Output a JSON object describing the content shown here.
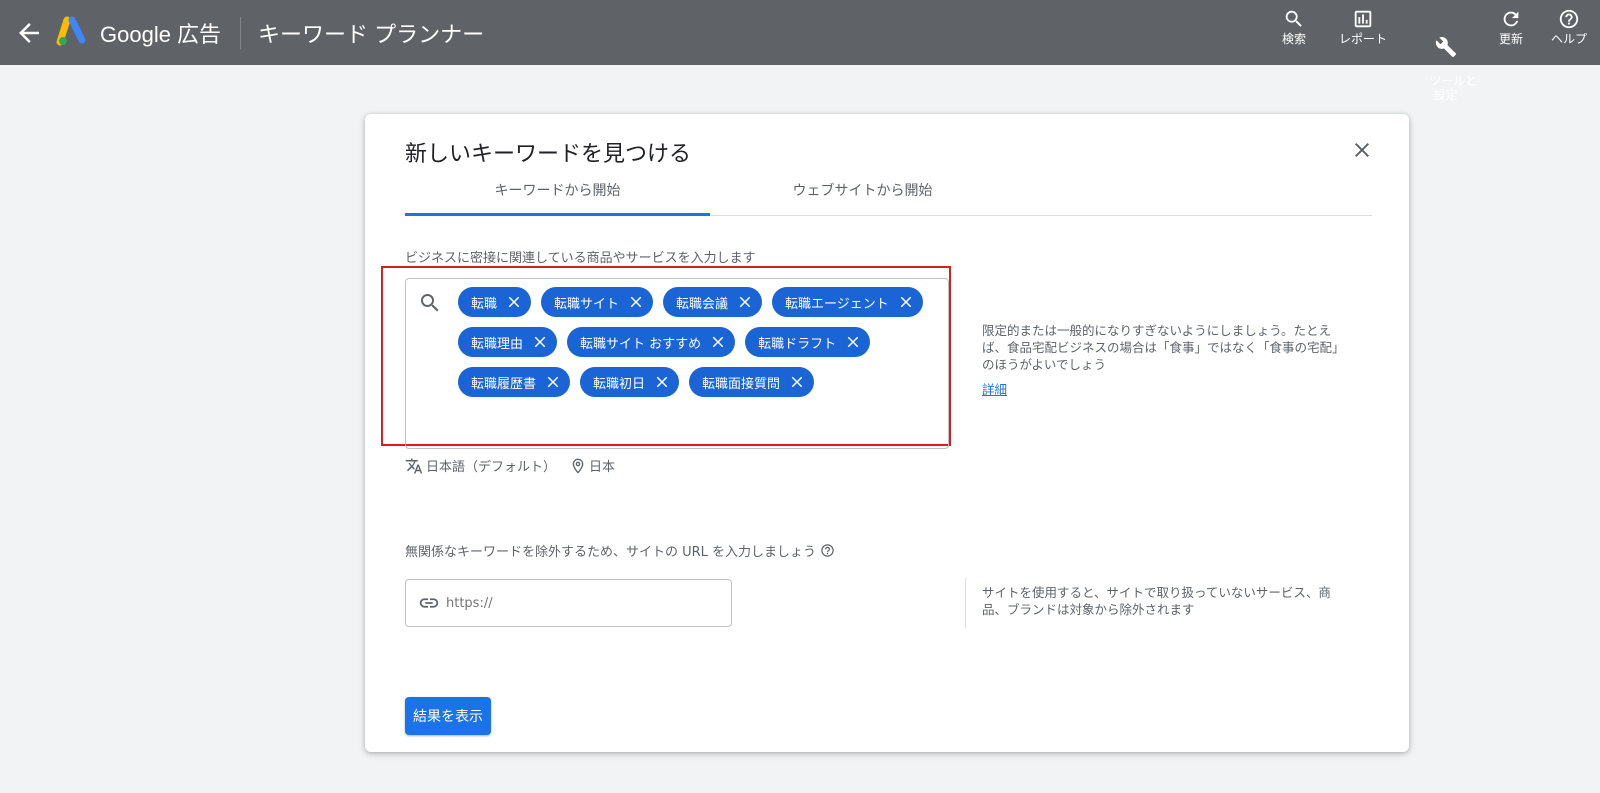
{
  "topbar": {
    "brand": "Google 広告",
    "page_title": "キーワード プランナー",
    "tools": [
      {
        "label": "検索",
        "icon": "search-icon"
      },
      {
        "label": "レポート",
        "icon": "bar-chart-icon"
      },
      {
        "label": "ツールと\n設定",
        "icon": "wrench-icon"
      },
      {
        "label": "更新",
        "icon": "refresh-icon"
      },
      {
        "label": "ヘルプ",
        "icon": "help-icon"
      }
    ]
  },
  "dialog": {
    "title": "新しいキーワードを見つける",
    "tabs": [
      {
        "label": "キーワードから開始",
        "active": true
      },
      {
        "label": "ウェブサイトから開始",
        "active": false
      }
    ],
    "keywords_label": "ビジネスに密接に関連している商品やサービスを入力します",
    "keywords": [
      [
        "転職",
        "転職サイト",
        "転職会議",
        "転職エージェント"
      ],
      [
        "転職理由",
        "転職サイト おすすめ",
        "転職ドラフト"
      ],
      [
        "転職履歴書",
        "転職初日",
        "転職面接質問"
      ]
    ],
    "hint": "限定的または一般的になりすぎないようにしましょう。たとえば、食品宅配ビジネスの場合は「食事」ではなく「食事の宅配」のほうがよいでしょう",
    "hint_link": "詳細",
    "language": "日本語（デフォルト）",
    "location": "日本",
    "url_label": "無関係なキーワードを除外するため、サイトの URL を入力しましょう",
    "url_placeholder": "https://",
    "url_hint": "サイトを使用すると、サイトで取り扱っていないサービス、商品、ブランドは対象から除外されます",
    "submit_label": "結果を表示"
  },
  "colors": {
    "topbar": "#5f6368",
    "chip": "#1a64d6",
    "accent": "#1a73e8",
    "highlight": "#e01b1b"
  }
}
